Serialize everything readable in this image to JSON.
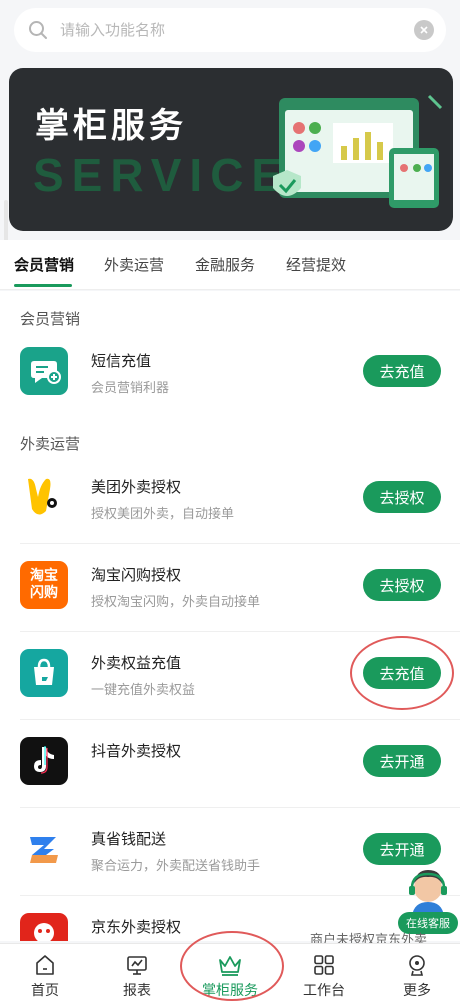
{
  "search": {
    "placeholder": "请输入功能名称"
  },
  "banner": {
    "title": "掌柜服务",
    "subtitle": "SERVICE"
  },
  "tabs": [
    {
      "label": "会员营销",
      "active": true
    },
    {
      "label": "外卖运营",
      "active": false
    },
    {
      "label": "金融服务",
      "active": false
    },
    {
      "label": "经营提效",
      "active": false
    }
  ],
  "sections": {
    "member": {
      "title": "会员营销"
    },
    "takeout": {
      "title": "外卖运营"
    }
  },
  "items": [
    {
      "name": "短信充值",
      "desc": "会员营销利器",
      "button": "去充值",
      "icon": "sms-icon"
    },
    {
      "name": "美团外卖授权",
      "desc": "授权美团外卖，自动接单",
      "button": "去授权",
      "icon": "meituan-icon"
    },
    {
      "name": "淘宝闪购授权",
      "desc": "授权淘宝闪购，外卖自动接单",
      "button": "去授权",
      "icon": "taobao-flash-icon",
      "icon_text": [
        "淘宝",
        "闪购"
      ]
    },
    {
      "name": "外卖权益充值",
      "desc": "一键充值外卖权益",
      "button": "去充值",
      "icon": "shopping-bag-icon"
    },
    {
      "name": "抖音外卖授权",
      "desc": "",
      "button": "去开通",
      "icon": "douyin-icon"
    },
    {
      "name": "真省钱配送",
      "desc": "聚合运力，外卖配送省钱助手",
      "button": "去开通",
      "icon": "delivery-z-icon"
    },
    {
      "name": "京东外卖授权",
      "desc": "",
      "button": "",
      "icon": "jd-dog-icon"
    }
  ],
  "customer_service": {
    "label": "在线客服"
  },
  "notice": "商户未授权京东外卖",
  "nav": [
    {
      "label": "首页",
      "icon": "home-icon",
      "active": false
    },
    {
      "label": "报表",
      "icon": "report-icon",
      "active": false
    },
    {
      "label": "掌柜服务",
      "icon": "crown-icon",
      "active": true
    },
    {
      "label": "工作台",
      "icon": "grid-icon",
      "active": false
    },
    {
      "label": "更多",
      "icon": "more-icon",
      "active": false
    }
  ],
  "colors": {
    "accent": "#1a9a5c",
    "annotation": "#e05a5a",
    "banner_bg": "#2b2e31"
  }
}
